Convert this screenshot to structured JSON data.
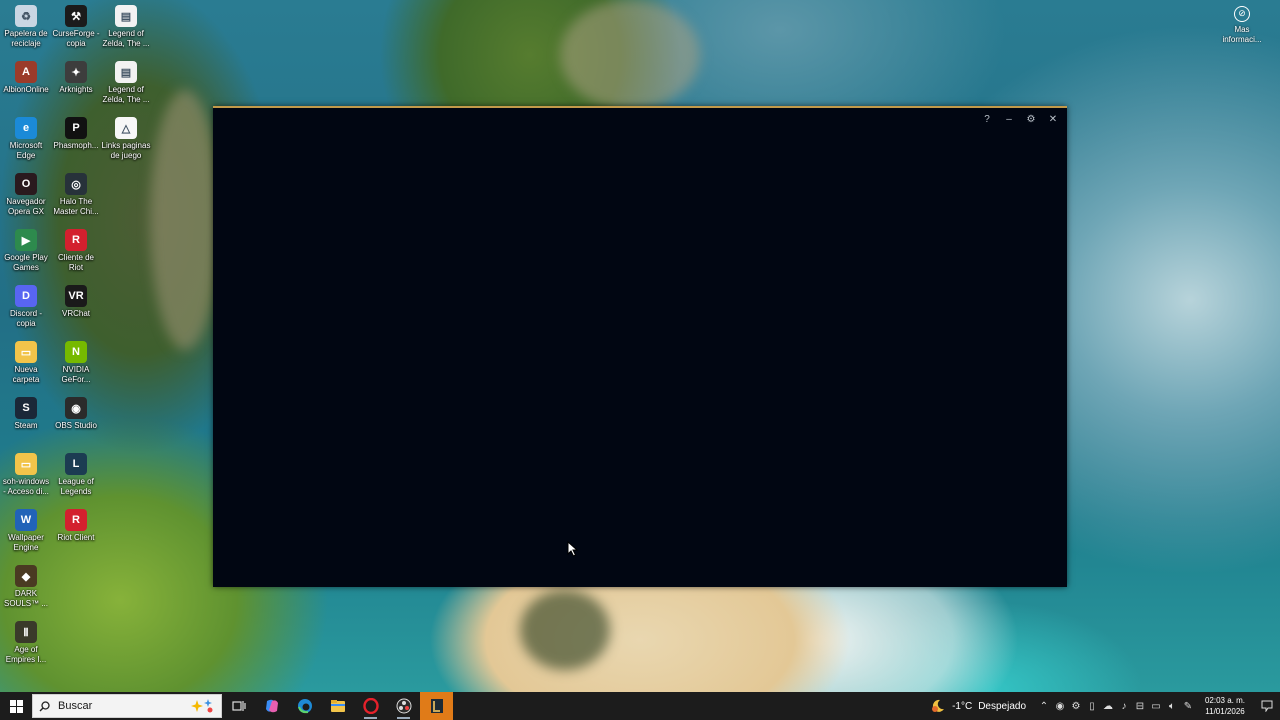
{
  "desktop": {
    "icons": [
      {
        "label": "Papelera de\nreciclaje",
        "icon": "recycle-bin-icon",
        "color": "#c9d6e3",
        "glyph": "♻"
      },
      {
        "label": "CurseForge -\ncopia",
        "icon": "curseforge-icon",
        "color": "#1b1b1b",
        "glyph": "⚒"
      },
      {
        "label": "Legend of\nZelda, The ...",
        "icon": "document-icon",
        "color": "#f2f2f2",
        "glyph": "▤"
      },
      {
        "label": "AlbionOnline",
        "icon": "albion-online-icon",
        "color": "#9b3b2a",
        "glyph": "A"
      },
      {
        "label": "Arknights",
        "icon": "arknights-icon",
        "color": "#3d3d3d",
        "glyph": "✦"
      },
      {
        "label": "Legend of\nZelda, The ...",
        "icon": "document-icon",
        "color": "#f2f2f2",
        "glyph": "▤"
      },
      {
        "label": "Microsoft\nEdge",
        "icon": "edge-icon",
        "color": "#1b8ad8",
        "glyph": "e"
      },
      {
        "label": "Phasmoph...",
        "icon": "phasmophobia-icon",
        "color": "#111111",
        "glyph": "P"
      },
      {
        "label": "Links paginas\nde juego",
        "icon": "document-icon",
        "color": "#f7f7f7",
        "glyph": "△"
      },
      {
        "label": "Navegador\nOpera GX",
        "icon": "opera-gx-icon",
        "color": "#2a1a1e",
        "glyph": "O"
      },
      {
        "label": "Halo The\nMaster Chi...",
        "icon": "halo-icon",
        "color": "#27323a",
        "glyph": "◎"
      },
      {
        "label": "Google Play\nGames",
        "icon": "google-play-games-icon",
        "color": "#2d8a4d",
        "glyph": "▶"
      },
      {
        "label": "Cliente de\nRiot",
        "icon": "riot-client-icon",
        "color": "#d3202e",
        "glyph": "R"
      },
      {
        "label": "Discord -\ncopia",
        "icon": "discord-icon",
        "color": "#5865f2",
        "glyph": "D"
      },
      {
        "label": "VRChat",
        "icon": "vrchat-icon",
        "color": "#1a1a1a",
        "glyph": "VR"
      },
      {
        "label": "Nueva\ncarpeta",
        "icon": "folder-icon",
        "color": "#f2c44a",
        "glyph": "▭"
      },
      {
        "label": "NVIDIA\nGeFor...",
        "icon": "nvidia-icon",
        "color": "#76b900",
        "glyph": "N"
      },
      {
        "label": "Steam",
        "icon": "steam-icon",
        "color": "#1b2838",
        "glyph": "S"
      },
      {
        "label": "OBS Studio",
        "icon": "obs-studio-icon",
        "color": "#2b2b2b",
        "glyph": "◉"
      },
      {
        "label": "soh-windows\n- Acceso di...",
        "icon": "folder-shortcut-icon",
        "color": "#f2c44a",
        "glyph": "▭"
      },
      {
        "label": "League of\nLegends",
        "icon": "league-of-legends-icon",
        "color": "#1c3c52",
        "glyph": "L"
      },
      {
        "label": "Wallpaper\nEngine",
        "icon": "wallpaper-engine-icon",
        "color": "#2163b8",
        "glyph": "W"
      },
      {
        "label": "Riot Client",
        "icon": "riot-client-icon",
        "color": "#d3202e",
        "glyph": "R"
      },
      {
        "label": "DARK\nSOULS™ ...",
        "icon": "dark-souls-icon",
        "color": "#4a3a22",
        "glyph": "◆"
      },
      {
        "label": "Age of\nEmpires I...",
        "icon": "age-of-empires-icon",
        "color": "#3a3a2a",
        "glyph": "Ⅱ"
      }
    ],
    "corner_widget": {
      "label": "Mas\ninformaci...",
      "icon": "info-circle-icon"
    }
  },
  "window": {
    "help_glyph": "?",
    "minimize_glyph": "–",
    "settings_glyph": "⚙",
    "close_glyph": "✕",
    "border_color": "#c29a4a",
    "background": "#010612"
  },
  "taskbar": {
    "search_placeholder": "Buscar",
    "apps": [
      {
        "name": "task-view-icon"
      },
      {
        "name": "copilot-icon"
      },
      {
        "name": "edge-icon"
      },
      {
        "name": "file-explorer-icon"
      },
      {
        "name": "opera-gx-icon"
      },
      {
        "name": "obs-studio-icon"
      },
      {
        "name": "league-of-legends-icon",
        "active": true
      }
    ],
    "weather": {
      "temp": "-1°C",
      "condition": "Despejado"
    },
    "clock": {
      "time": "02:03 a. m.",
      "date": "11/01/2026"
    },
    "accent_color": "#e07b18"
  }
}
